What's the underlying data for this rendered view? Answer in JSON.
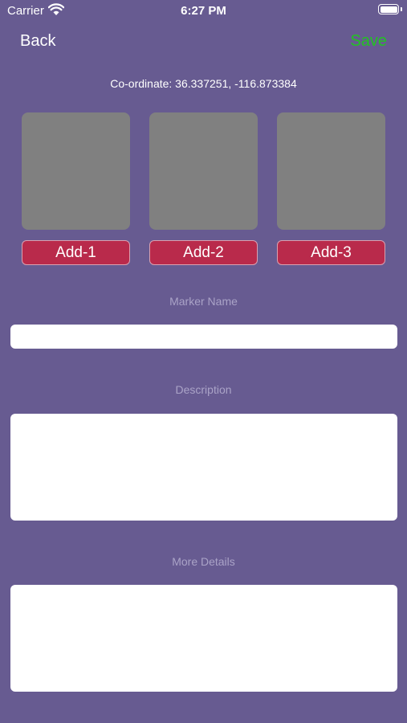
{
  "status_bar": {
    "carrier": "Carrier",
    "time": "6:27 PM",
    "wifi_icon": "wifi-icon",
    "battery_icon": "battery-icon"
  },
  "nav": {
    "back_label": "Back",
    "save_label": "Save",
    "save_color": "#22c322"
  },
  "coordinate_text": "Co-ordinate: 36.337251, -116.873384",
  "image_slots": [
    {
      "button_label": "Add-1"
    },
    {
      "button_label": "Add-2"
    },
    {
      "button_label": "Add-3"
    }
  ],
  "form": {
    "marker_name_label": "Marker Name",
    "marker_name_value": "",
    "description_label": "Description",
    "description_value": "",
    "more_details_label": "More Details",
    "more_details_value": ""
  },
  "colors": {
    "background": "#675b91",
    "add_button": "#b92a4b",
    "image_placeholder": "#808080"
  }
}
